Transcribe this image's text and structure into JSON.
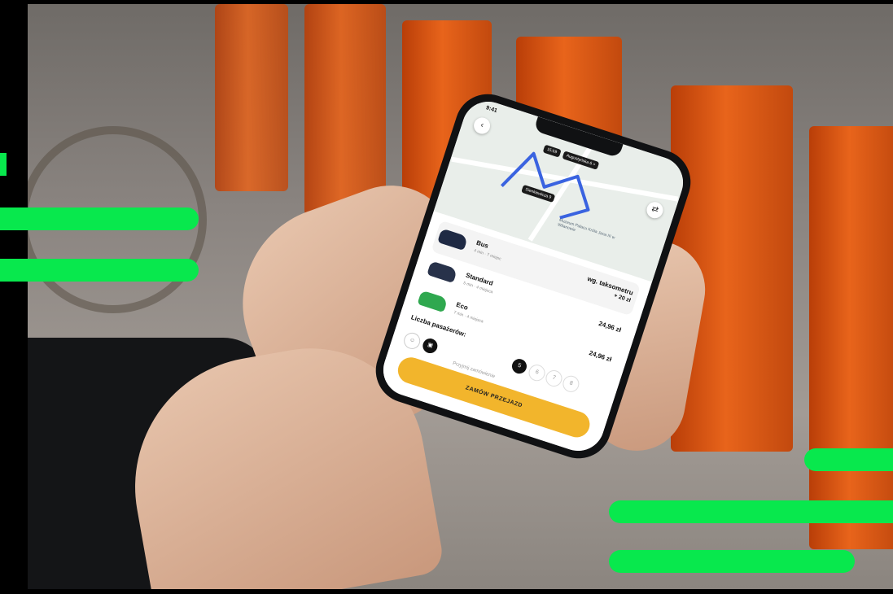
{
  "app": {
    "status_time": "9:41",
    "accent_color": "#F2B52C",
    "stripe_color": "#08E84D"
  },
  "map": {
    "eta_tag": "15:59",
    "destination_tag": "Augustyńska 6 >",
    "origin_tag": "Sienkiewicza 9",
    "poi_label": "Muzeum Pałacu Króla Jana III w Wilanowie",
    "back_icon": "chevron-left-icon",
    "swap_icon": "swap-icon"
  },
  "rides": [
    {
      "name": "Bus",
      "meta": "4 min  ·  7 miejsc",
      "price": "wg. taksometru",
      "extra": "+ 20 zł",
      "selected": true,
      "car_color": "#1f2a44"
    },
    {
      "name": "Standard",
      "meta": "5 min  ·  4 miejsca",
      "price": "24,96 zł",
      "extra": "",
      "selected": false,
      "car_color": "#28324a"
    },
    {
      "name": "Eco",
      "meta": "7 min  ·  4 miejsca",
      "price": "24,96 zł",
      "extra": "",
      "selected": false,
      "car_color": "#2fa84f"
    }
  ],
  "passengers": {
    "label": "Liczba pasażerów:",
    "options": [
      "5",
      "6",
      "7",
      "8"
    ],
    "selected": "5",
    "preference_placeholder": "Przyjmij zamówienie"
  },
  "order_button": {
    "label": "ZAMÓW PRZEJAZD"
  }
}
